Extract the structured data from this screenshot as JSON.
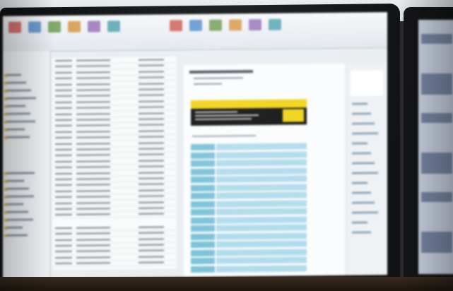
{
  "scene": {
    "description_colors": {
      "ribbon": "#e8edf2",
      "banner_yellow": "#f0d41a",
      "table_blue_dark": "#7ec3d9",
      "table_blue_light": "#b2dceb",
      "folder_icon": "#d9b44a"
    },
    "primary_monitor": {
      "app_window": {
        "ribbon_buttons": [
          "new-mail-icon",
          "delete-icon",
          "reply-icon",
          "reply-all-icon",
          "forward-icon",
          "quick-steps-icon",
          "move-icon",
          "rules-icon",
          "tags-icon",
          "flag-icon",
          "find-icon",
          "send-receive-icon"
        ],
        "folder_pane_items": 18,
        "message_rows": 34,
        "reading_pane_table_rows": 16,
        "todo_bar_items": 14
      }
    },
    "secondary_monitor": {
      "content_blocks": 6
    }
  }
}
